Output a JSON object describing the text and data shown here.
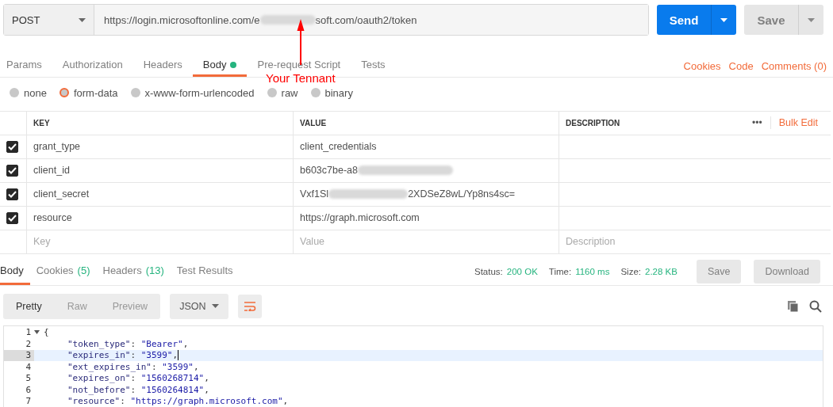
{
  "request": {
    "method": "POST",
    "url_parts": [
      "https://login.microsoftonline.com/e",
      "soft.com/oauth2/token"
    ],
    "redacted": true,
    "send": "Send",
    "save": "Save"
  },
  "annotation": {
    "text": "Your Tennant"
  },
  "request_tabs": [
    {
      "label": "Params",
      "selected": false,
      "dot": false
    },
    {
      "label": "Authorization",
      "selected": false,
      "dot": false
    },
    {
      "label": "Headers",
      "selected": false,
      "dot": false
    },
    {
      "label": "Body",
      "selected": true,
      "dot": true
    },
    {
      "label": "Pre-request Script",
      "selected": false,
      "dot": false
    },
    {
      "label": "Tests",
      "selected": false,
      "dot": false
    }
  ],
  "request_links": [
    "Cookies",
    "Code",
    "Comments (0)"
  ],
  "body_types": [
    {
      "label": "none",
      "selected": false
    },
    {
      "label": "form-data",
      "selected": true
    },
    {
      "label": "x-www-form-urlencoded",
      "selected": false
    },
    {
      "label": "raw",
      "selected": false
    },
    {
      "label": "binary",
      "selected": false
    }
  ],
  "table": {
    "columns": [
      "KEY",
      "VALUE",
      "DESCRIPTION"
    ],
    "more": "•••",
    "bulk_edit": "Bulk Edit",
    "rows": [
      {
        "key": "grant_type",
        "value_parts": [
          "client_credentials"
        ],
        "redacted": false,
        "checked": true
      },
      {
        "key": "client_id",
        "value_parts": [
          "b603c7be-a8"
        ],
        "redacted": true,
        "checked": true
      },
      {
        "key": "client_secret",
        "value_parts": [
          "Vxf1Sl",
          "2XDSeZ8wL/Yp8ns4sc="
        ],
        "redacted": true,
        "checked": true
      },
      {
        "key": "resource",
        "value_parts": [
          "https://graph.microsoft.com"
        ],
        "redacted": false,
        "checked": true
      }
    ],
    "placeholders": [
      "Key",
      "Value",
      "Description"
    ]
  },
  "response_tabs": [
    {
      "label": "Body",
      "selected": true
    },
    {
      "label": "Cookies",
      "count": "(5)",
      "selected": false
    },
    {
      "label": "Headers",
      "count": "(13)",
      "selected": false
    },
    {
      "label": "Test Results",
      "selected": false
    }
  ],
  "status": [
    {
      "label": "Status:",
      "value": "200 OK"
    },
    {
      "label": "Time:",
      "value": "1160 ms"
    },
    {
      "label": "Size:",
      "value": "2.28 KB"
    }
  ],
  "response_buttons": [
    "Save",
    "Download"
  ],
  "view_modes": [
    {
      "label": "Pretty",
      "selected": true
    },
    {
      "label": "Raw",
      "selected": false
    },
    {
      "label": "Preview",
      "selected": false
    }
  ],
  "format": "JSON",
  "code_lines": [
    {
      "number": "1",
      "fold": true,
      "highlighted": false,
      "cursor": false,
      "segments": [
        {
          "kind": "punct",
          "text": "{"
        }
      ]
    },
    {
      "number": "2",
      "fold": false,
      "highlighted": false,
      "cursor": false,
      "segments": [
        {
          "kind": "key",
          "text": "\"token_type\""
        },
        {
          "kind": "punct",
          "text": ": "
        },
        {
          "kind": "string",
          "text": "\"Bearer\""
        },
        {
          "kind": "punct",
          "text": ","
        }
      ]
    },
    {
      "number": "3",
      "fold": false,
      "highlighted": true,
      "cursor": true,
      "segments": [
        {
          "kind": "key",
          "text": "\"expires_in\""
        },
        {
          "kind": "punct",
          "text": ": "
        },
        {
          "kind": "string",
          "text": "\"3599\""
        },
        {
          "kind": "punct",
          "text": ","
        }
      ]
    },
    {
      "number": "4",
      "fold": false,
      "highlighted": false,
      "cursor": false,
      "segments": [
        {
          "kind": "key",
          "text": "\"ext_expires_in\""
        },
        {
          "kind": "punct",
          "text": ": "
        },
        {
          "kind": "string",
          "text": "\"3599\""
        },
        {
          "kind": "punct",
          "text": ","
        }
      ]
    },
    {
      "number": "5",
      "fold": false,
      "highlighted": false,
      "cursor": false,
      "segments": [
        {
          "kind": "key",
          "text": "\"expires_on\""
        },
        {
          "kind": "punct",
          "text": ": "
        },
        {
          "kind": "string",
          "text": "\"1560268714\""
        },
        {
          "kind": "punct",
          "text": ","
        }
      ]
    },
    {
      "number": "6",
      "fold": false,
      "highlighted": false,
      "cursor": false,
      "segments": [
        {
          "kind": "key",
          "text": "\"not_before\""
        },
        {
          "kind": "punct",
          "text": ": "
        },
        {
          "kind": "string",
          "text": "\"1560264814\""
        },
        {
          "kind": "punct",
          "text": ","
        }
      ]
    },
    {
      "number": "7",
      "fold": false,
      "highlighted": false,
      "cursor": false,
      "segments": [
        {
          "kind": "key",
          "text": "\"resource\""
        },
        {
          "kind": "punct",
          "text": ": "
        },
        {
          "kind": "string",
          "text": "\"https://graph.microsoft.com\""
        },
        {
          "kind": "punct",
          "text": ","
        }
      ]
    }
  ]
}
